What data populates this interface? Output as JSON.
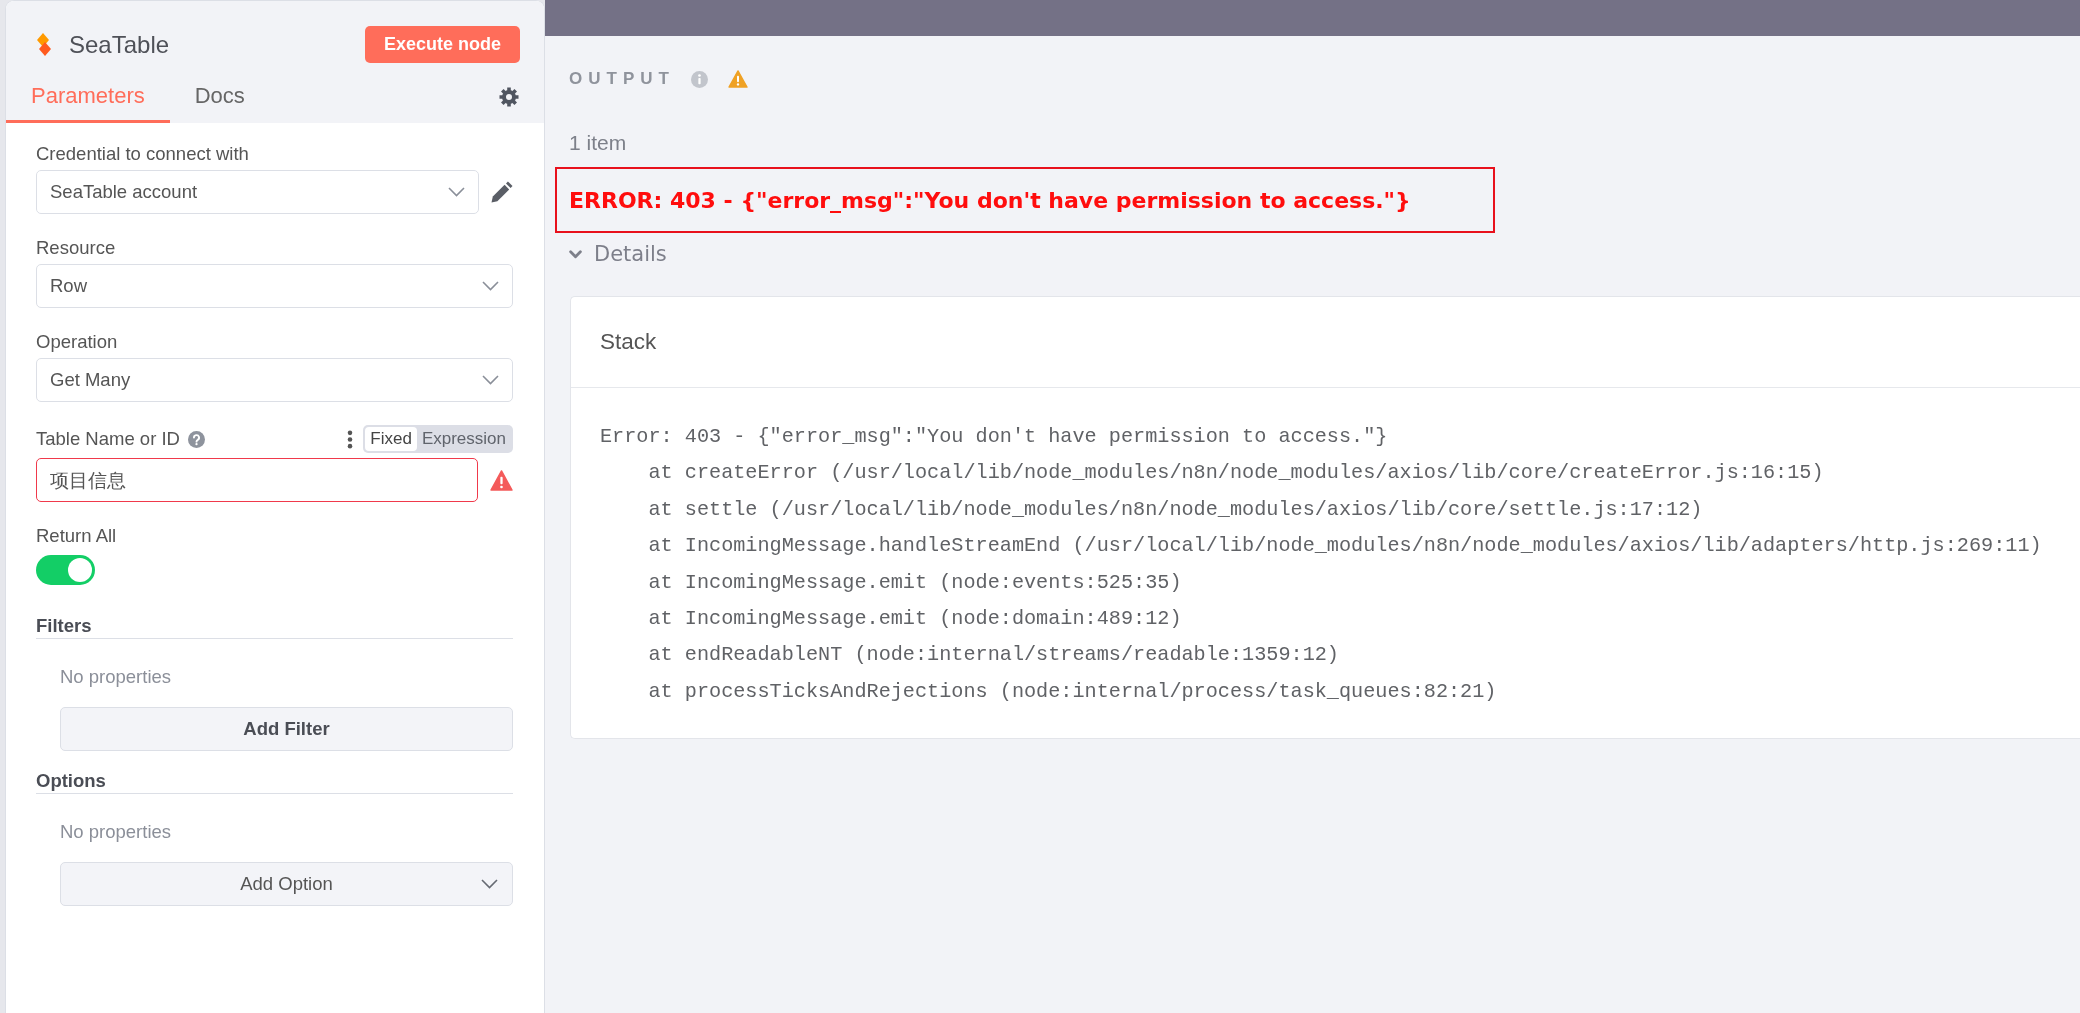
{
  "panel": {
    "title": "SeaTable",
    "execute_button": "Execute node",
    "tabs": [
      {
        "label": "Parameters",
        "selected": true
      },
      {
        "label": "Docs",
        "selected": false
      }
    ],
    "fields": [
      {
        "kind": "select",
        "label": "Credential to connect with",
        "value": "SeaTable account",
        "invalid": false,
        "edit_button": true
      },
      {
        "kind": "select",
        "label": "Resource",
        "value": "Row",
        "invalid": false
      },
      {
        "kind": "select",
        "label": "Operation",
        "value": "Get Many",
        "invalid": false
      },
      {
        "kind": "input",
        "label": "Table Name or ID",
        "help": true,
        "value": "项目信息",
        "invalid": true,
        "modes": [
          {
            "label": "Fixed",
            "selected": true
          },
          {
            "label": "Expression",
            "selected": false
          }
        ]
      },
      {
        "kind": "toggle",
        "label": "Return All",
        "on": true
      }
    ],
    "collections": [
      {
        "kind": "button",
        "title": "Filters",
        "empty_text": "No properties",
        "button": "Add Filter"
      },
      {
        "kind": "dropdown",
        "title": "Options",
        "empty_text": "No properties",
        "button": "Add Option"
      }
    ]
  },
  "output": {
    "title": "OUTPUT",
    "count": "1 item",
    "error": "ERROR: 403 - {\"error_msg\":\"You don't have permission to access.\"}",
    "details": {
      "label": "Details",
      "expanded": true
    },
    "stack": {
      "title": "Stack",
      "message": "Error: 403 - {\"error_msg\":\"You don't have permission to access.\"}",
      "frames": [
        "at createError (/usr/local/lib/node_modules/n8n/node_modules/axios/lib/core/createError.js:16:15)",
        "at settle (/usr/local/lib/node_modules/n8n/node_modules/axios/lib/core/settle.js:17:12)",
        "at IncomingMessage.handleStreamEnd (/usr/local/lib/node_modules/n8n/node_modules/axios/lib/adapters/http.js:269:11)",
        "at IncomingMessage.emit (node:events:525:35)",
        "at IncomingMessage.emit (node:domain:489:12)",
        "at endReadableNT (node:internal/streams/readable:1359:12)",
        "at processTicksAndRejections (node:internal/process/task_queues:82:21)"
      ]
    }
  }
}
